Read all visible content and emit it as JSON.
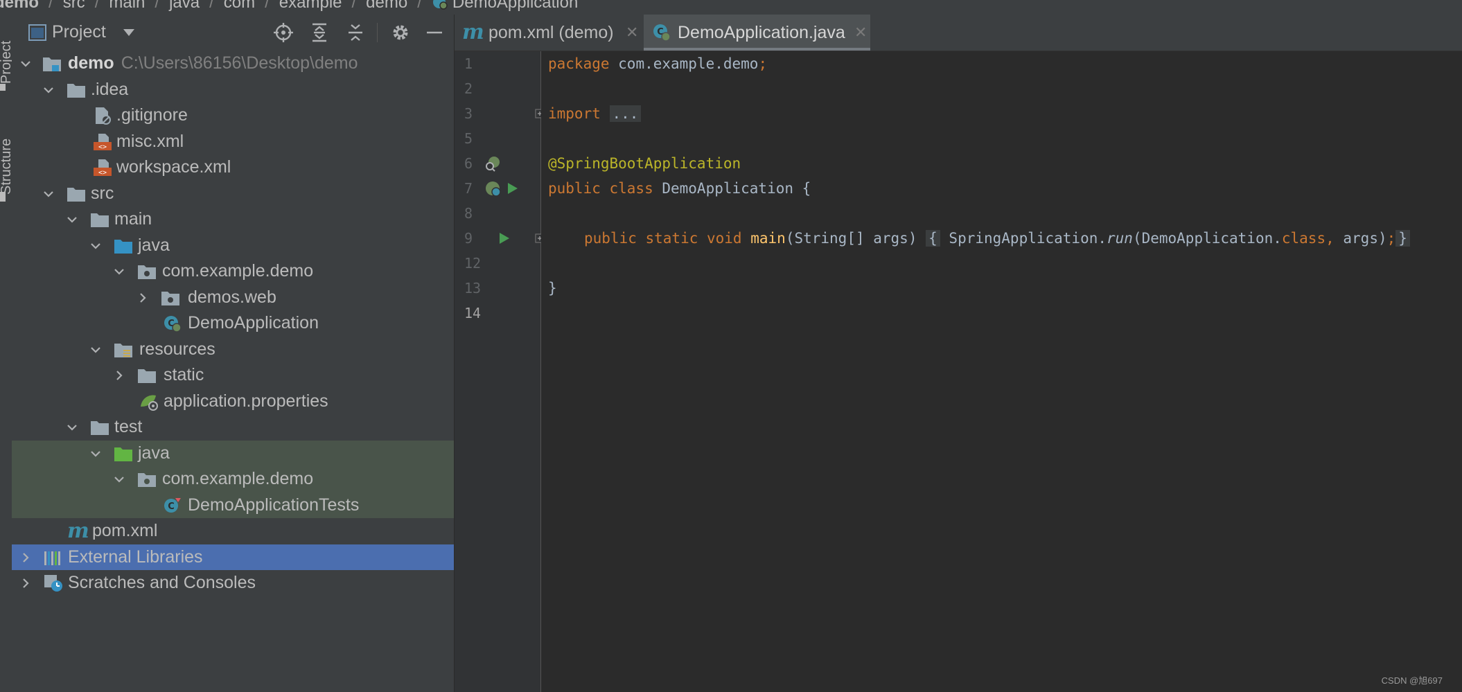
{
  "breadcrumb": [
    "demo",
    "src",
    "main",
    "java",
    "com",
    "example",
    "demo",
    "DemoApplication"
  ],
  "stripe": {
    "project_label": "Project",
    "structure_label": "Structure"
  },
  "panel": {
    "title": "Project"
  },
  "tree": [
    {
      "label": "demo",
      "path": "C:\\Users\\86156\\Desktop\\demo"
    },
    {
      "label": ".idea"
    },
    {
      "label": ".gitignore"
    },
    {
      "label": "misc.xml"
    },
    {
      "label": "workspace.xml"
    },
    {
      "label": "src"
    },
    {
      "label": "main"
    },
    {
      "label": "java"
    },
    {
      "label": "com.example.demo"
    },
    {
      "label": "demos.web"
    },
    {
      "label": "DemoApplication"
    },
    {
      "label": "resources"
    },
    {
      "label": "static"
    },
    {
      "label": "application.properties"
    },
    {
      "label": "test"
    },
    {
      "label": "java"
    },
    {
      "label": "com.example.demo"
    },
    {
      "label": "DemoApplicationTests"
    },
    {
      "label": "pom.xml"
    },
    {
      "label": "External Libraries"
    },
    {
      "label": "Scratches and Consoles"
    }
  ],
  "tabs": [
    {
      "label": "pom.xml (demo)"
    },
    {
      "label": "DemoApplication.java"
    }
  ],
  "editor": {
    "line_numbers": [
      "1",
      "2",
      "3",
      "5",
      "6",
      "7",
      "8",
      "9",
      "12",
      "13",
      "14"
    ],
    "code": {
      "l1_kw": "package",
      "l1_rest": " com.example.demo",
      "l1_semi": ";",
      "l3_kw": "import",
      "l3_fold": "...",
      "l6_ann": "@SpringBootApplication",
      "l7_kw": "public class",
      "l7_rest": " DemoApplication {",
      "l9_kw": "public static void",
      "l9_fn": "main",
      "l9_args": "(String[] args)",
      "l9_open": "{",
      "l9_call": " SpringApplication.",
      "l9_run": "run",
      "l9_param": "(DemoApplication.",
      "l9_class": "class",
      "l9_comma": ",",
      "l9_tail": " args)",
      "l9_semi": ";",
      "l9_close": "}",
      "l13_brace": "}"
    }
  },
  "watermark": "CSDN @旭697",
  "colors": {
    "accent_selected": "#4b6eaf",
    "test_bg": "#49544a",
    "keyword": "#cc7832",
    "annotation": "#bbb529",
    "function": "#ffc66d"
  }
}
